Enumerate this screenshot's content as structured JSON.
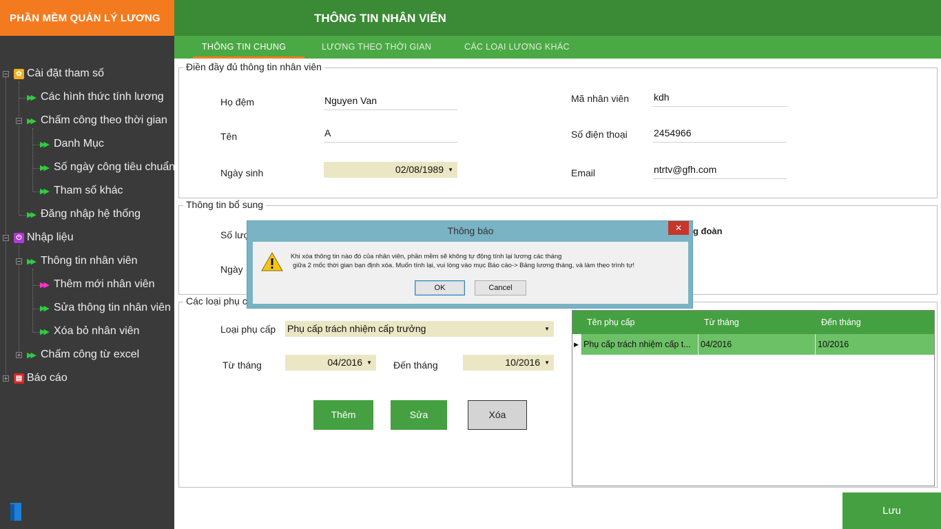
{
  "app": {
    "title": "PHẦN MỀM QUẢN LÝ LƯƠNG",
    "page_title": "THÔNG TIN NHÂN VIÊN"
  },
  "tabs": [
    "THÔNG TIN CHUNG",
    "LƯƠNG THEO THỜI GIAN",
    "CÁC LOẠI LƯƠNG KHÁC"
  ],
  "sidebar": {
    "items": [
      "Cài đặt tham số",
      "Các hình thức tính lương",
      "Chấm công theo thời gian",
      "Danh Mục",
      "Số ngày công tiêu chuẩn",
      "Tham số khác",
      "Đăng nhập hệ thống",
      "Nhập liệu",
      "Thông tin nhân viên",
      "Thêm mới nhân viên",
      "Sửa thông tin nhân viên",
      "Xóa bỏ nhân viên",
      "Chấm công từ excel",
      "Báo cáo"
    ],
    "icons": [
      "gear-icon",
      "power-icon",
      "report-icon",
      "door-icon"
    ]
  },
  "info": {
    "group_title": "Điền đầy đủ thông tin nhân viên",
    "ho_dem_label": "Họ đệm",
    "ho_dem": "Nguyen Van",
    "ten_label": "Tên",
    "ten": "A",
    "ngay_sinh_label": "Ngày sinh",
    "ngay_sinh": "02/08/1989",
    "ma_nv_label": "Mã nhân viên",
    "ma_nv": "kdh",
    "sdt_label": "Số điện thoại",
    "sdt": "2454966",
    "email_label": "Email",
    "email": "ntrtv@gfh.com"
  },
  "extra": {
    "group_title": "Thông tin bổ sung",
    "so_luong_label_partial": "Số lượ",
    "ngay_label_partial": "Ngày",
    "cong_doan_partial": "g đoàn"
  },
  "allowance": {
    "group_title_partial": "Các loại phụ c",
    "loai_label": "Loại phụ cấp",
    "loai_value": "Phụ cấp trách nhiệm cấp trưởng",
    "tu_thang_label": "Từ tháng",
    "tu_thang": "04/2016",
    "den_thang_label": "Đến tháng",
    "den_thang": "10/2016",
    "buttons": {
      "add": "Thêm",
      "edit": "Sửa",
      "delete": "Xóa"
    }
  },
  "grid": {
    "columns": [
      "Tên phụ cấp",
      "Từ tháng",
      "Đến tháng"
    ],
    "rows": [
      [
        "Phụ cấp trách nhiệm cấp t...",
        "04/2016",
        "10/2016"
      ]
    ]
  },
  "save_button": "Lưu",
  "dialog": {
    "title": "Thông báo",
    "close": "✕",
    "message_line1": "Khi xóa thông tin nào đó của nhân viên, phần mềm sẽ không tự động tính lại lương các tháng",
    "message_line2": "giữa 2 mốc thời gian bạn định xóa. Muốn tính lại, vui lòng vào mục Báo cáo-> Bảng lương tháng, và làm theo trình tự!",
    "ok": "OK",
    "cancel": "Cancel"
  },
  "colors": {
    "orange": "#f47a20",
    "green_dark": "#3b8a35",
    "green": "#45a041",
    "sidebar": "#3a3a3a"
  }
}
